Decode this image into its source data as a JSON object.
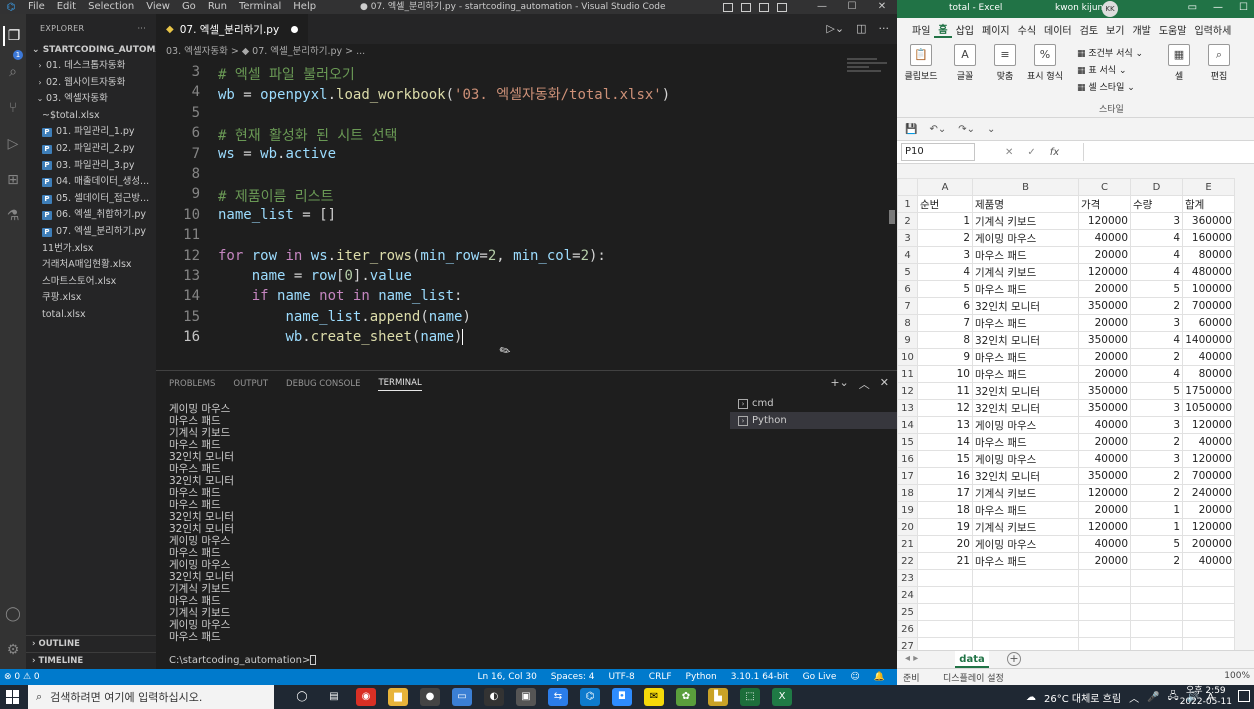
{
  "vscode": {
    "menu": [
      "File",
      "Edit",
      "Selection",
      "View",
      "Go",
      "Run",
      "Terminal",
      "Help"
    ],
    "window_title": "● 07. 엑셀_분리하기.py - startcoding_automation - Visual Studio Code",
    "explorer_label": "EXPLORER",
    "project": "STARTCODING_AUTOMATI...",
    "tree": [
      {
        "label": "01. 데스크톱자동화",
        "type": "folder",
        "open": false,
        "indent": 0
      },
      {
        "label": "02. 웹사이트자동화",
        "type": "folder",
        "open": false,
        "indent": 0
      },
      {
        "label": "03. 엑셀자동화",
        "type": "folder",
        "open": true,
        "indent": 0
      },
      {
        "label": "~$total.xlsx",
        "type": "xlsx",
        "indent": 1
      },
      {
        "label": "01. 파일관리_1.py",
        "type": "py",
        "indent": 1
      },
      {
        "label": "02. 파일관리_2.py",
        "type": "py",
        "indent": 1
      },
      {
        "label": "03. 파일관리_3.py",
        "type": "py",
        "indent": 1
      },
      {
        "label": "04. 매출데이터_생성...",
        "type": "py",
        "indent": 1
      },
      {
        "label": "05. 셀데이터_접근방...",
        "type": "py",
        "indent": 1
      },
      {
        "label": "06. 엑셀_취합하기.py",
        "type": "py",
        "indent": 1
      },
      {
        "label": "07. 엑셀_분리하기.py",
        "type": "py",
        "indent": 1
      },
      {
        "label": "11번가.xlsx",
        "type": "xlsx",
        "indent": 1
      },
      {
        "label": "거래처A매입현황.xlsx",
        "type": "xlsx",
        "indent": 1
      },
      {
        "label": "스마트스토어.xlsx",
        "type": "xlsx",
        "indent": 1
      },
      {
        "label": "쿠팡.xlsx",
        "type": "xlsx",
        "indent": 1
      },
      {
        "label": "total.xlsx",
        "type": "xlsx",
        "indent": 1
      }
    ],
    "outline_label": "OUTLINE",
    "timeline_label": "TIMELINE",
    "tab_label": "07. 엑셀_분리하기.py",
    "breadcrumb": "03. 엑셀자동화 > ◆ 07. 엑셀_분리하기.py > ...",
    "code_lines": [
      {
        "n": "3",
        "parts": [
          [
            "c-com",
            "# 엑셀 파일 불러오기"
          ]
        ]
      },
      {
        "n": "4",
        "parts": [
          [
            "c-var",
            "wb"
          ],
          [
            "c-op",
            " = "
          ],
          [
            "c-var",
            "openpyxl"
          ],
          [
            "c-op",
            "."
          ],
          [
            "c-fn",
            "load_workbook"
          ],
          [
            "c-op",
            "("
          ],
          [
            "c-str",
            "'03. 엑셀자동화/total.xlsx'"
          ],
          [
            "c-op",
            ")"
          ]
        ]
      },
      {
        "n": "5",
        "parts": []
      },
      {
        "n": "6",
        "parts": [
          [
            "c-com",
            "# 현재 활성화 된 시트 선택"
          ]
        ]
      },
      {
        "n": "7",
        "parts": [
          [
            "c-var",
            "ws"
          ],
          [
            "c-op",
            " = "
          ],
          [
            "c-var",
            "wb"
          ],
          [
            "c-op",
            "."
          ],
          [
            "c-var",
            "active"
          ]
        ]
      },
      {
        "n": "8",
        "parts": []
      },
      {
        "n": "9",
        "parts": [
          [
            "c-com",
            "# 제품이름 리스트"
          ]
        ]
      },
      {
        "n": "10",
        "parts": [
          [
            "c-var",
            "name_list"
          ],
          [
            "c-op",
            " = []"
          ]
        ]
      },
      {
        "n": "11",
        "parts": []
      },
      {
        "n": "12",
        "parts": [
          [
            "c-kw",
            "for"
          ],
          [
            "c-op",
            " "
          ],
          [
            "c-var",
            "row"
          ],
          [
            "c-op",
            " "
          ],
          [
            "c-kw",
            "in"
          ],
          [
            "c-op",
            " "
          ],
          [
            "c-var",
            "ws"
          ],
          [
            "c-op",
            "."
          ],
          [
            "c-fn",
            "iter_rows"
          ],
          [
            "c-op",
            "("
          ],
          [
            "c-var",
            "min_row"
          ],
          [
            "c-op",
            "="
          ],
          [
            "c-num",
            "2"
          ],
          [
            "c-op",
            ", "
          ],
          [
            "c-var",
            "min_col"
          ],
          [
            "c-op",
            "="
          ],
          [
            "c-num",
            "2"
          ],
          [
            "c-op",
            "):"
          ]
        ]
      },
      {
        "n": "13",
        "parts": [
          [
            "c-op",
            "    "
          ],
          [
            "c-var",
            "name"
          ],
          [
            "c-op",
            " = "
          ],
          [
            "c-var",
            "row"
          ],
          [
            "c-op",
            "["
          ],
          [
            "c-num",
            "0"
          ],
          [
            "c-op",
            "]."
          ],
          [
            "c-var",
            "value"
          ]
        ]
      },
      {
        "n": "14",
        "parts": [
          [
            "c-op",
            "    "
          ],
          [
            "c-kw",
            "if"
          ],
          [
            "c-op",
            " "
          ],
          [
            "c-var",
            "name"
          ],
          [
            "c-op",
            " "
          ],
          [
            "c-kw",
            "not in"
          ],
          [
            "c-op",
            " "
          ],
          [
            "c-var",
            "name_list"
          ],
          [
            "c-op",
            ":"
          ]
        ]
      },
      {
        "n": "15",
        "parts": [
          [
            "c-op",
            "        "
          ],
          [
            "c-var",
            "name_list"
          ],
          [
            "c-op",
            "."
          ],
          [
            "c-fn",
            "append"
          ],
          [
            "c-op",
            "("
          ],
          [
            "c-var",
            "name"
          ],
          [
            "c-op",
            ")"
          ]
        ]
      },
      {
        "n": "16",
        "parts": [
          [
            "c-op",
            "        "
          ],
          [
            "c-var",
            "wb"
          ],
          [
            "c-op",
            "."
          ],
          [
            "c-fn",
            "create_sheet"
          ],
          [
            "c-op",
            "("
          ],
          [
            "c-var",
            "name"
          ],
          [
            "c-op",
            ")"
          ]
        ]
      }
    ],
    "panel_tabs": [
      "PROBLEMS",
      "OUTPUT",
      "DEBUG CONSOLE",
      "TERMINAL"
    ],
    "terminal_lines": [
      "게이밍 마우스",
      "마우스 패드",
      "기계식 키보드",
      "마우스 패드",
      "32인치 모니터",
      "마우스 패드",
      "32인치 모니터",
      "마우스 패드",
      "마우스 패드",
      "32인치 모니터",
      "32인치 모니터",
      "게이밍 마우스",
      "마우스 패드",
      "게이밍 마우스",
      "32인치 모니터",
      "기계식 키보드",
      "마우스 패드",
      "기계식 키보드",
      "게이밍 마우스",
      "마우스 패드"
    ],
    "terminal_prompt": "C:\\startcoding_automation>",
    "terminal_list": [
      "cmd",
      "Python"
    ],
    "status_left": "⊗ 0 ⚠ 0",
    "status_right": [
      "Ln 16, Col 30",
      "Spaces: 4",
      "UTF-8",
      "CRLF",
      "Python",
      "3.10.1 64-bit",
      "Go Live"
    ]
  },
  "excel": {
    "title": "total - Excel",
    "user": "kwon kijun",
    "user_initials": "KK",
    "ribbon_tabs": [
      "파일",
      "홈",
      "삽입",
      "페이지",
      "수식",
      "데이터",
      "검토",
      "보기",
      "개발",
      "도움말",
      "입력하세"
    ],
    "ribbon_groups": [
      "클립보드",
      "글꼴",
      "맞춤",
      "표시 형식",
      "셀",
      "편집"
    ],
    "style_items": [
      "조건부 서식",
      "표 서식",
      "셀 스타일"
    ],
    "style_group_label": "스타일",
    "namebox": "P10",
    "fx_label": "fx",
    "col_headers": [
      "A",
      "B",
      "C",
      "D",
      "E"
    ],
    "rows": [
      [
        "1",
        "순번",
        "제품명",
        "가격",
        "수량",
        "합계"
      ],
      [
        "2",
        "1",
        "기계식 키보드",
        "120000",
        "3",
        "360000"
      ],
      [
        "3",
        "2",
        "게이밍 마우스",
        "40000",
        "4",
        "160000"
      ],
      [
        "4",
        "3",
        "마우스 패드",
        "20000",
        "4",
        "80000"
      ],
      [
        "5",
        "4",
        "기계식 키보드",
        "120000",
        "4",
        "480000"
      ],
      [
        "6",
        "5",
        "마우스 패드",
        "20000",
        "5",
        "100000"
      ],
      [
        "7",
        "6",
        "32인치 모니터",
        "350000",
        "2",
        "700000"
      ],
      [
        "8",
        "7",
        "마우스 패드",
        "20000",
        "3",
        "60000"
      ],
      [
        "9",
        "8",
        "32인치 모니터",
        "350000",
        "4",
        "1400000"
      ],
      [
        "10",
        "9",
        "마우스 패드",
        "20000",
        "2",
        "40000"
      ],
      [
        "11",
        "10",
        "마우스 패드",
        "20000",
        "4",
        "80000"
      ],
      [
        "12",
        "11",
        "32인치 모니터",
        "350000",
        "5",
        "1750000"
      ],
      [
        "13",
        "12",
        "32인치 모니터",
        "350000",
        "3",
        "1050000"
      ],
      [
        "14",
        "13",
        "게이밍 마우스",
        "40000",
        "3",
        "120000"
      ],
      [
        "15",
        "14",
        "마우스 패드",
        "20000",
        "2",
        "40000"
      ],
      [
        "16",
        "15",
        "게이밍 마우스",
        "40000",
        "3",
        "120000"
      ],
      [
        "17",
        "16",
        "32인치 모니터",
        "350000",
        "2",
        "700000"
      ],
      [
        "18",
        "17",
        "기계식 키보드",
        "120000",
        "2",
        "240000"
      ],
      [
        "19",
        "18",
        "마우스 패드",
        "20000",
        "1",
        "20000"
      ],
      [
        "20",
        "19",
        "기계식 키보드",
        "120000",
        "1",
        "120000"
      ],
      [
        "21",
        "20",
        "게이밍 마우스",
        "40000",
        "5",
        "200000"
      ],
      [
        "22",
        "21",
        "마우스 패드",
        "20000",
        "2",
        "40000"
      ],
      [
        "23",
        "",
        "",
        "",
        "",
        ""
      ],
      [
        "24",
        "",
        "",
        "",
        "",
        ""
      ],
      [
        "25",
        "",
        "",
        "",
        "",
        ""
      ],
      [
        "26",
        "",
        "",
        "",
        "",
        ""
      ],
      [
        "27",
        "",
        "",
        "",
        "",
        ""
      ]
    ],
    "sheet_tab": "data",
    "status_ready": "준비",
    "status_accessibility": "디스플레이 설정",
    "zoom": "100%"
  },
  "taskbar": {
    "search_placeholder": "검색하려면 여기에 입력하십시오.",
    "weather": "26°C 대체로 흐림",
    "time": "오후 2:59",
    "date": "2022-05-11",
    "ime": "A"
  }
}
